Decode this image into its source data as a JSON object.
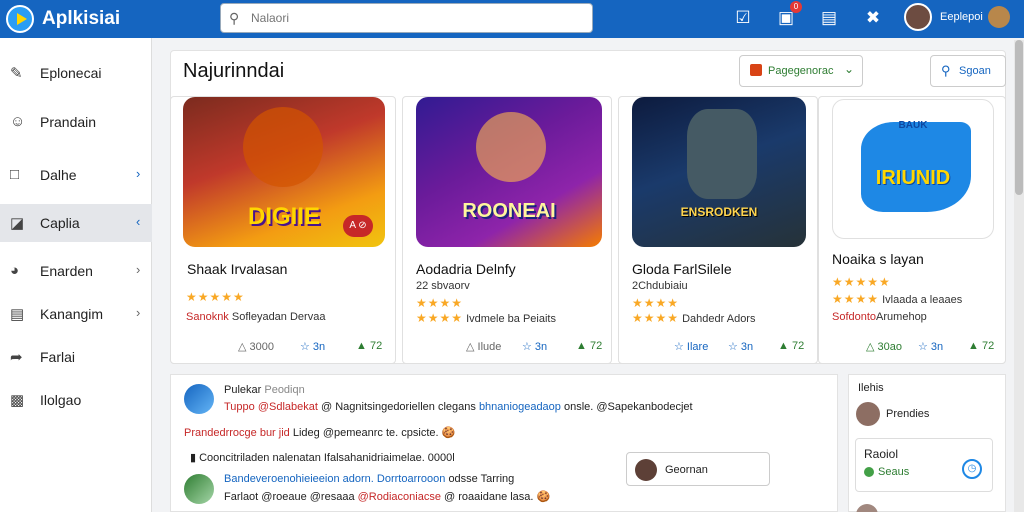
{
  "header": {
    "app_name": "Aplkisiai",
    "search_placeholder": "Nalaori",
    "notification_count": "0",
    "username": "Eeplepoi"
  },
  "sidebar": {
    "items": [
      {
        "label": "Eplonecai",
        "icon": "edit-icon"
      },
      {
        "label": "Prandain",
        "icon": "user-icon"
      },
      {
        "label": "Dalhe",
        "icon": "camera-icon",
        "chevron": "›"
      },
      {
        "label": "Caplia",
        "icon": "tag-icon",
        "chevron": "‹",
        "active": true
      },
      {
        "label": "Enarden",
        "icon": "google-icon",
        "chevron": "›"
      },
      {
        "label": "Kanangim",
        "icon": "list-icon",
        "chevron": "›"
      },
      {
        "label": "Farlai",
        "icon": "share-icon"
      },
      {
        "label": "Ilolgao",
        "icon": "download-icon"
      }
    ]
  },
  "main": {
    "title": "Najurinndai",
    "filter_label": "Pagegenorac",
    "search_button": "Sgoan"
  },
  "cards": [
    {
      "image_text": "DIGIIE",
      "image_badge": "A ⊘",
      "title": "Shaak Irvalasan",
      "subtitle": "",
      "stars": "★★★★★",
      "meta_red": "Sanoknk",
      "meta": "Sofleyadan Dervaa",
      "stats": [
        "3000",
        "3n",
        "72"
      ]
    },
    {
      "image_text": "ROONEAI",
      "title": "Aodadria Delnfy",
      "subtitle": "22 sbvaorv",
      "stars": "★★★★",
      "stars2": "★★★★",
      "meta": "Ivdmele ba Peiaits",
      "stats": [
        "Ilude",
        "3n",
        "72"
      ]
    },
    {
      "image_text": "ENSRODKEN",
      "title": "Gloda FarlSilele",
      "subtitle": "2Chdubiaiu",
      "stars": "★★★★",
      "stars2": "★★★★",
      "meta": "Dahdedr Adors",
      "stats": [
        "Ilare",
        "3n",
        "72"
      ]
    },
    {
      "image_text": "IRIUNID",
      "image_sub": "BAUK",
      "title": "Noaika s layan",
      "subtitle": "",
      "stars": "★★★★★",
      "stars2": "★★★★",
      "meta_red": "Sofdonto",
      "meta": "Arumehop",
      "meta_right": "Ivlaada a leaaes",
      "stats": [
        "30ao",
        "3n",
        "72"
      ]
    }
  ],
  "feed": {
    "posts": [
      {
        "name": "Pulekar",
        "time": "Peodiqn",
        "line1_blue": "Tuppo @Sdlabekat",
        "line1": "@ Nagnitsingedoriellen clegans",
        "line1_blue2": "bhnaniogeadaop",
        "line1_end": "onsle. @Sapekanbodecjet"
      },
      {
        "line2_red": "Prandedrrocge bur jid",
        "line2": "Lideg @pemeanrc te. cpsicte. 🍪"
      },
      {
        "line3": "Cooncitriladen nalenatan Ifalsahanidriaimelae. 0000l"
      },
      {
        "line4_blue": "Bandeveroenohieieeion adorn. Dorrtoarrooon",
        "line4": "odsse Tarring",
        "line5": "Farlaot @roeaue @resaaa",
        "line5_red": "@Rodiaconiacse",
        "line5_b": "@ roaaidane lasa. 🍪"
      }
    ],
    "contact_label": "Geornan"
  },
  "right_panel": {
    "heading": "Ilehis",
    "person_name": "Prendies",
    "box_title": "Raoiol",
    "box_status": "Seaus"
  }
}
